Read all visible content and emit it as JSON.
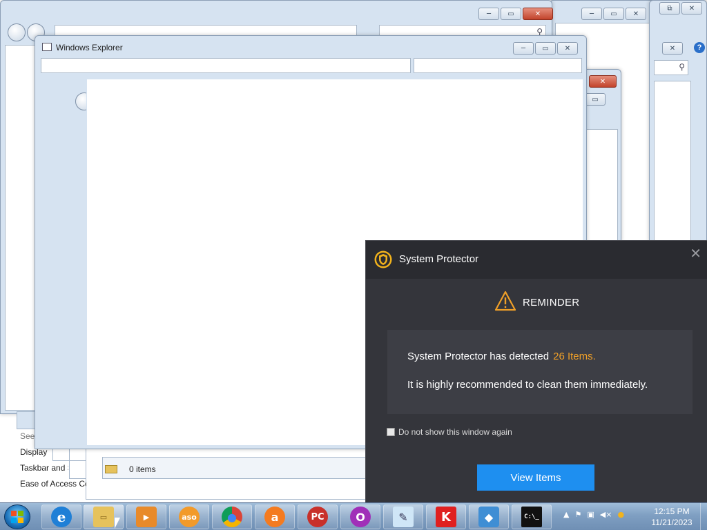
{
  "background_windows": {
    "search_glyph": "⚲",
    "minimize_glyph": "─",
    "maximize_glyph": "▭",
    "close_glyph": "✕",
    "restore_glyph": "⧉",
    "help_glyph": "?"
  },
  "control_panel_fragment": {
    "see_also": "See",
    "items": [
      "Display",
      "Taskbar and S",
      "Ease of Access Cen"
    ]
  },
  "explorer": {
    "title": "Windows Explorer",
    "status_items": "0 items"
  },
  "popup": {
    "app_name": "System Protector",
    "close_glyph": "✕",
    "heading": "REMINDER",
    "message_prefix": "System Protector has detected",
    "detected_count": "26 Items.",
    "message_line2": "It is highly recommended to clean them immediately.",
    "checkbox_label": "Do not show this window again",
    "checkbox_checked": false,
    "button_label": "View Items",
    "colors": {
      "background": "#2b2c31",
      "panel": "#3d3e45",
      "accent_orange": "#f0a028",
      "button_blue": "#1e8ff0"
    }
  },
  "taskbar": {
    "apps": [
      {
        "name": "internet-explorer",
        "glyph": "e"
      },
      {
        "name": "windows-explorer",
        "glyph": "▭"
      },
      {
        "name": "media-player",
        "glyph": "▶"
      },
      {
        "name": "ashampoo",
        "glyph": "aso"
      },
      {
        "name": "chrome",
        "glyph": "●"
      },
      {
        "name": "avast",
        "glyph": "a"
      },
      {
        "name": "pc-matic",
        "glyph": "PC"
      },
      {
        "name": "opera",
        "glyph": "O"
      },
      {
        "name": "notepad",
        "glyph": "✎"
      },
      {
        "name": "kaspersky",
        "glyph": "K"
      },
      {
        "name": "virtualbox",
        "glyph": "◆"
      },
      {
        "name": "command-prompt",
        "glyph": "C:\\_"
      }
    ],
    "tray_glyphs": [
      "▲",
      "⚑",
      "▣",
      "◀×",
      "●"
    ],
    "time": "12:15 PM",
    "date": "11/21/2023"
  }
}
